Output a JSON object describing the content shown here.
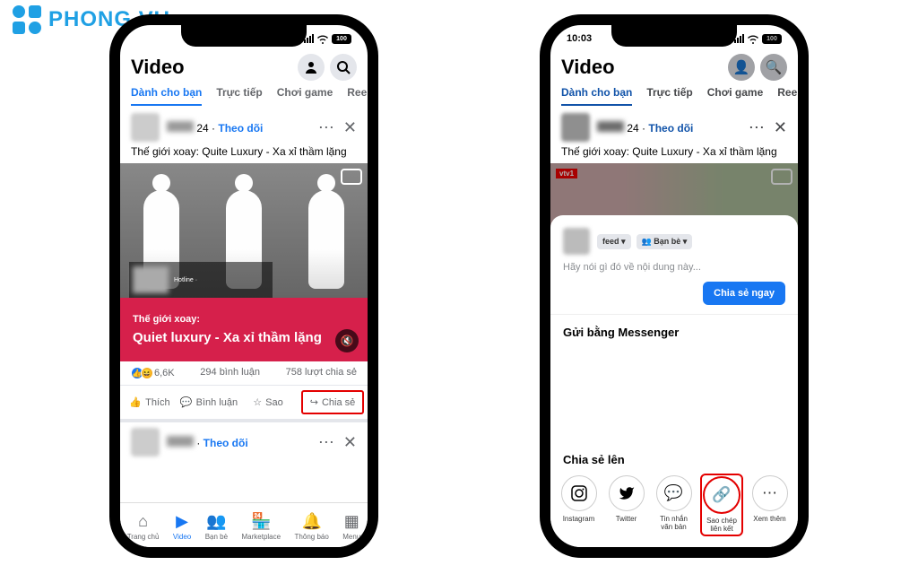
{
  "logo": {
    "text": "PHONG VU"
  },
  "status": {
    "time": "10:03",
    "battery": "100"
  },
  "header": {
    "title": "Video"
  },
  "tabs": [
    "Dành cho bạn",
    "Trực tiếp",
    "Chơi game",
    "Ree"
  ],
  "post": {
    "time_suffix": "24",
    "follow": "Theo dõi",
    "caption": "Thế giới xoay: Quite Luxury - Xa xỉ thầm lặng",
    "banner_small": "Thế giới xoay:",
    "banner_big": "Quiet luxury - Xa xỉ thầm lặng",
    "reactions": "6,6K",
    "comments": "294 bình luận",
    "shares": "758 lượt chia sẻ"
  },
  "actions": {
    "like": "Thích",
    "comment": "Bình luận",
    "star": "Sao",
    "share": "Chia sẻ"
  },
  "nav": [
    {
      "label": "Trang chủ"
    },
    {
      "label": "Video"
    },
    {
      "label": "Bạn bè"
    },
    {
      "label": "Marketplace"
    },
    {
      "label": "Thông báo"
    },
    {
      "label": "Menu"
    }
  ],
  "sheet": {
    "feed_chip": "feed ▾",
    "audience_chip": "Bạn bè ▾",
    "placeholder": "Hãy nói gì đó về nội dung này...",
    "share_now": "Chia sẻ ngay",
    "messenger_title": "Gửi bằng Messenger",
    "share_to_title": "Chia sẻ lên",
    "options": [
      {
        "label": "Instagram"
      },
      {
        "label": "Twitter"
      },
      {
        "label": "Tin nhắn văn bản"
      },
      {
        "label": "Sao chép liên kết"
      },
      {
        "label": "Xem thêm"
      }
    ]
  },
  "video2_channel": "vtv1"
}
